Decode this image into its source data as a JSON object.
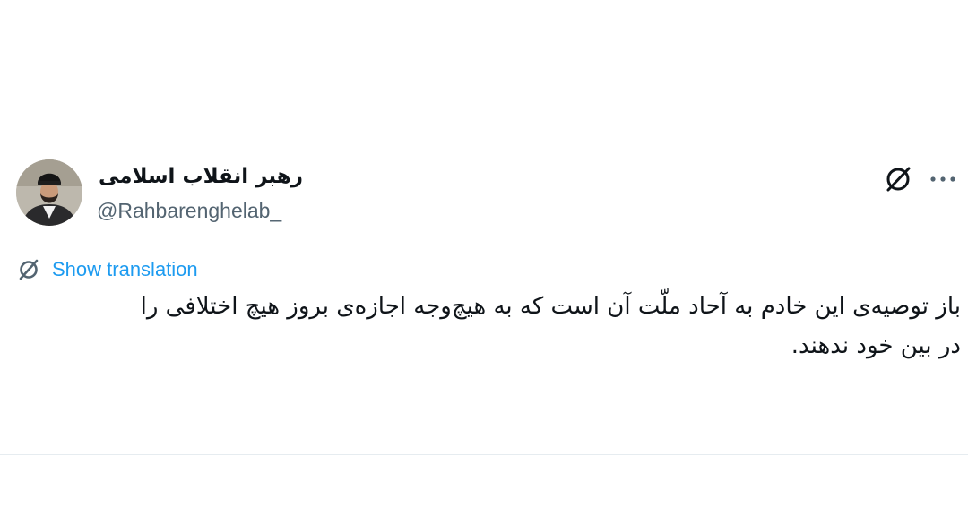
{
  "author": {
    "name": "رهبر انقلاب اسلامی",
    "handle": "@Rahbarenghelab_",
    "avatar_icon": "profile-photo"
  },
  "header_actions": {
    "grok_icon": "grok-icon",
    "more_icon": "more-options-icon"
  },
  "translation": {
    "label": "Show translation",
    "icon": "translate-icon",
    "color": "#1d9bf0"
  },
  "tweet": {
    "lines": [
      "باز توصیه‌ی این خادم به آحاد ملّت آن است که به هیچ‌وجه اجازه‌ی بروز هیچ اختلافی را",
      "در بین خود ندهند."
    ]
  },
  "colors": {
    "text": "#0f1419",
    "secondary": "#536471",
    "link": "#1d9bf0"
  }
}
